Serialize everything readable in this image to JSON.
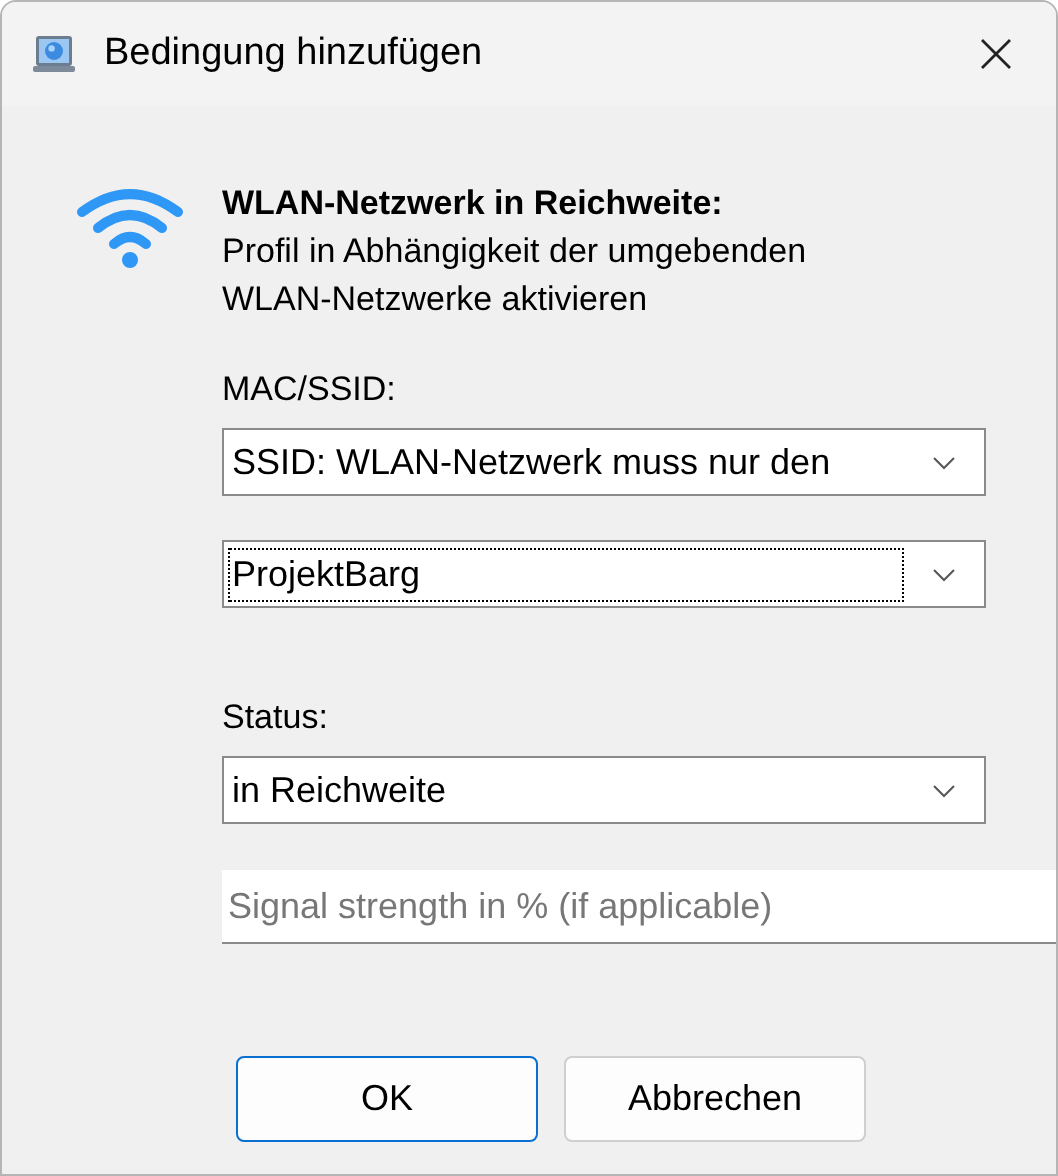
{
  "window": {
    "title": "Bedingung hinzufügen"
  },
  "heading": "WLAN-Netzwerk in Reichweite:",
  "description": "Profil in Abhängigkeit der umgebenden WLAN-Netzwerke aktivieren",
  "fields": [
    {
      "kind": "label",
      "text": "MAC/SSID:"
    },
    {
      "kind": "dropdown",
      "value": "SSID: WLAN-Netzwerk muss nur den",
      "focused": false
    },
    {
      "kind": "dropdown",
      "value": "ProjektBarg",
      "focused": true
    },
    {
      "kind": "label",
      "text": "Status:"
    },
    {
      "kind": "dropdown",
      "value": "in Reichweite",
      "focused": false
    },
    {
      "kind": "input",
      "placeholder": "Signal strength in % (if applicable)"
    }
  ],
  "buttons": [
    {
      "label": "OK",
      "default": true
    },
    {
      "label": "Abbrechen",
      "default": false
    }
  ]
}
